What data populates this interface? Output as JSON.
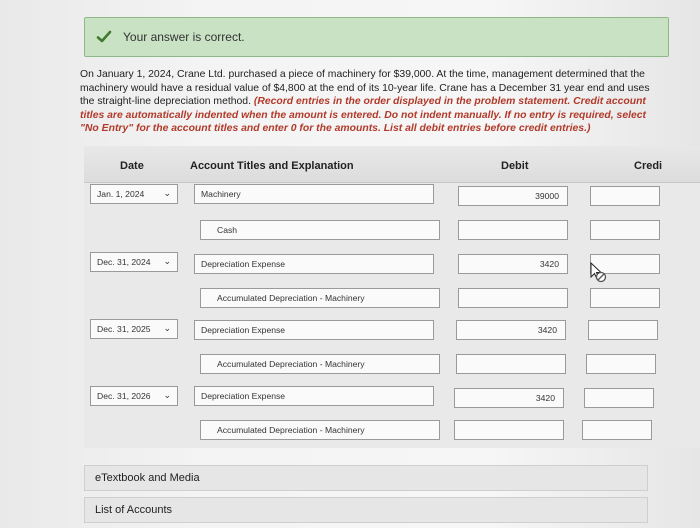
{
  "feedback": {
    "message": "Your answer is correct.",
    "icon": "check-icon",
    "color": "#4a7a3a"
  },
  "problem": {
    "text": "On January 1, 2024, Crane Ltd. purchased a piece of machinery for $39,000. At the time, management determined that the machinery would have a residual value of $4,800 at the end of its 10-year life. Crane has a December 31 year end and uses the straight-line depreciation method.",
    "instructions": "(Record entries in the order displayed in the problem statement. Credit account titles are automatically indented when the amount is entered. Do not indent manually. If no entry is required, select \"No Entry\" for the account titles and enter 0 for the amounts. List all debit entries before credit entries.)"
  },
  "table": {
    "headers": {
      "date": "Date",
      "account": "Account Titles and Explanation",
      "debit": "Debit",
      "credit": "Credi"
    },
    "rows": [
      {
        "date": "Jan. 1, 2024",
        "account": "Machinery",
        "debit": "39000",
        "credit": ""
      },
      {
        "date": "",
        "account": "Cash",
        "debit": "",
        "credit": ""
      },
      {
        "date": "Dec. 31, 2024",
        "account": "Depreciation Expense",
        "debit": "3420",
        "credit": ""
      },
      {
        "date": "",
        "account": "Accumulated Depreciation - Machinery",
        "debit": "",
        "credit": ""
      },
      {
        "date": "Dec. 31, 2025",
        "account": "Depreciation Expense",
        "debit": "3420",
        "credit": ""
      },
      {
        "date": "",
        "account": "Accumulated Depreciation - Machinery",
        "debit": "",
        "credit": ""
      },
      {
        "date": "Dec. 31, 2026",
        "account": "Depreciation Expense",
        "debit": "3420",
        "credit": ""
      },
      {
        "date": "",
        "account": "Accumulated Depreciation - Machinery",
        "debit": "",
        "credit": ""
      }
    ]
  },
  "links": {
    "etextbook": "eTextbook and Media",
    "accounts": "List of Accounts"
  }
}
